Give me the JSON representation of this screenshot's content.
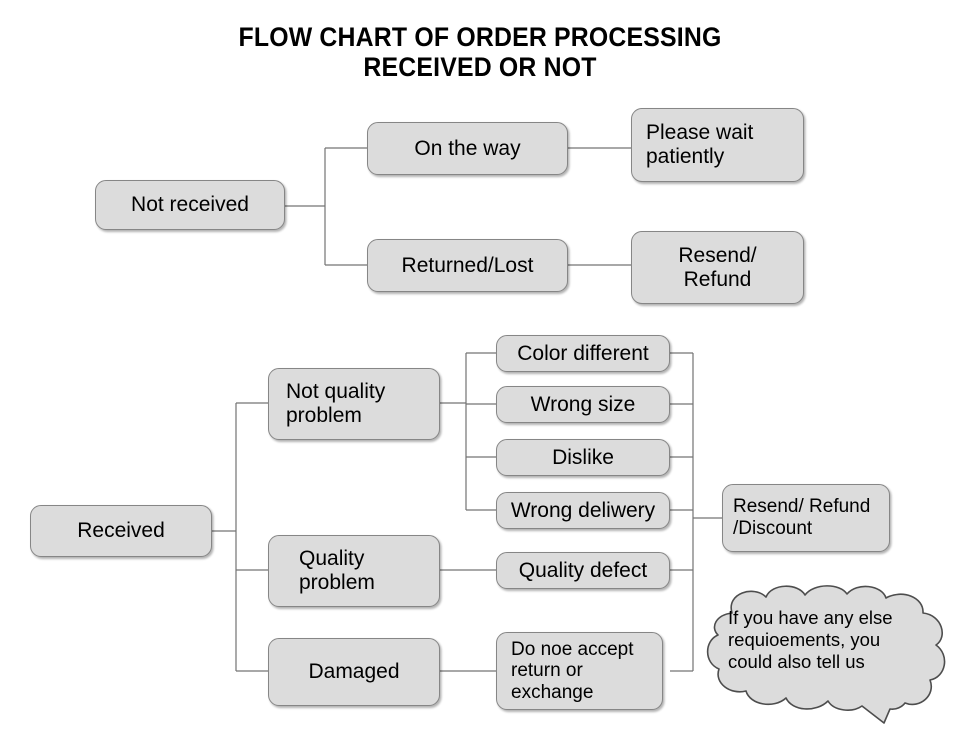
{
  "title": {
    "line1": "FLOW CHART OF ORDER PROCESSING",
    "line2": "RECEIVED OR NOT"
  },
  "nodes": {
    "not_received": "Not received",
    "on_the_way": "On the way",
    "please_wait": "Please wait\npatiently",
    "returned_lost": "Returned/Lost",
    "resend_refund": "Resend/\nRefund",
    "received": "Received",
    "not_quality_problem": "Not quality\nproblem",
    "quality_problem": "Quality\nproblem",
    "damaged": "Damaged",
    "color_different": "Color different",
    "wrong_size": "Wrong size",
    "dislike": "Dislike",
    "wrong_delivery": "Wrong deliwery",
    "quality_defect": "Quality defect",
    "do_not_accept": "Do noe accept\nreturn or\nexchange",
    "resend_refund_discount": "Resend/ Refund\n/Discount"
  },
  "bubble": {
    "text": "If you have any else\nrequioements, you\ncould also tell us"
  },
  "colors": {
    "node_fill": "#dcdcdc",
    "node_border": "#868686",
    "connector": "#737373",
    "bubble_fill": "#dcdcdc",
    "bubble_border": "#4d4d4d",
    "background": "#ffffff",
    "text": "#000000"
  },
  "chart_data": {
    "type": "diagram",
    "title": "FLOW CHART OF ORDER PROCESSING RECEIVED OR NOT",
    "branches": [
      {
        "root": "Not received",
        "children": [
          {
            "label": "On the way",
            "outcome": "Please wait patiently"
          },
          {
            "label": "Returned/Lost",
            "outcome": "Resend/ Refund"
          }
        ]
      },
      {
        "root": "Received",
        "children": [
          {
            "label": "Not quality problem",
            "reasons": [
              "Color different",
              "Wrong size",
              "Dislike",
              "Wrong deliwery"
            ],
            "outcome": "Resend/ Refund /Discount"
          },
          {
            "label": "Quality problem",
            "reasons": [
              "Quality defect"
            ],
            "outcome": "Resend/ Refund /Discount"
          },
          {
            "label": "Damaged",
            "reasons": [
              "Do noe accept return or exchange"
            ],
            "outcome": ""
          }
        ]
      }
    ],
    "note": "If you have any else requioements, you could also tell us"
  }
}
